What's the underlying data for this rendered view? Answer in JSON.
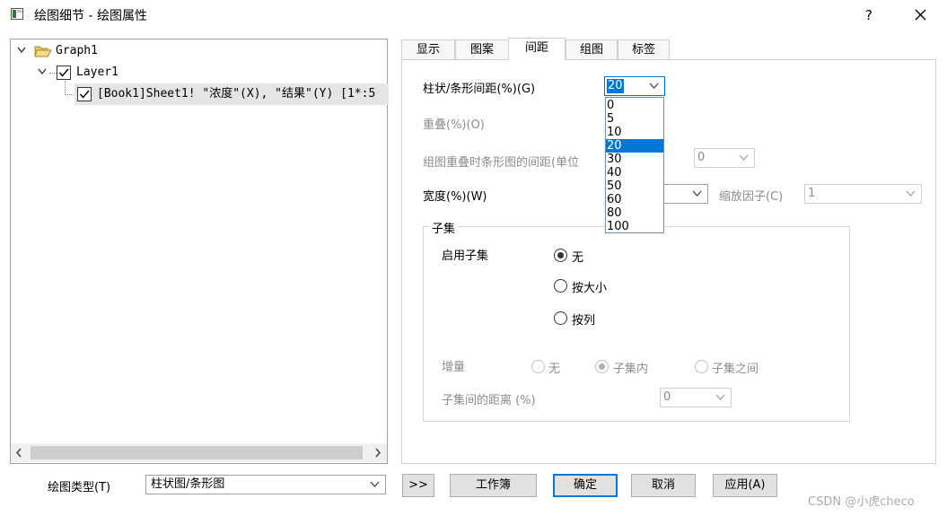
{
  "window": {
    "title": "绘图细节 - 绘图属性",
    "help": "?",
    "close": "×"
  },
  "tree": {
    "root": "Graph1",
    "layer": "Layer1",
    "plot": "[Book1]Sheet1! \"浓度\"(X), \"结果\"(Y) [1*:5"
  },
  "tabs": [
    {
      "label": "显示"
    },
    {
      "label": "图案"
    },
    {
      "label": "间距"
    },
    {
      "label": "组图"
    },
    {
      "label": "标签"
    }
  ],
  "active_tab": "间距",
  "spacing": {
    "gap_label": "柱状/条形间距(%)(G)",
    "gap_value": "20",
    "gap_options": [
      "0",
      "5",
      "10",
      "20",
      "30",
      "40",
      "50",
      "60",
      "80",
      "100"
    ],
    "gap_selected": "20",
    "overlap_label": "重叠(%)(O)",
    "group_overlap_label": "组图重叠时条形图的间距(单位",
    "group_overlap_value": "0",
    "width_label": "宽度(%)(W)",
    "scale_label": "缩放因子(C)",
    "scale_value": "1"
  },
  "subset": {
    "title": "子集",
    "enable_label": "启用子集",
    "enable_options": [
      {
        "label": "无",
        "checked": true
      },
      {
        "label": "按大小",
        "checked": false
      },
      {
        "label": "按列",
        "checked": false
      }
    ],
    "increment_label": "增量",
    "increment_options": [
      {
        "label": "无",
        "checked": false
      },
      {
        "label": "子集内",
        "checked": true
      },
      {
        "label": "子集之间",
        "checked": false
      }
    ],
    "distance_label": "子集间的距离 (%)",
    "distance_value": "0"
  },
  "bottom": {
    "plot_type_label": "绘图类型(T)",
    "plot_type_value": "柱状图/条形图",
    "expand_label": ">>",
    "workbook_label": "工作簿",
    "ok_label": "确定",
    "cancel_label": "取消",
    "apply_label": "应用(A)"
  },
  "watermark": "CSDN @小虎checo",
  "colors": {
    "accent": "#0078d7",
    "disabled": "#8c8c8c"
  }
}
